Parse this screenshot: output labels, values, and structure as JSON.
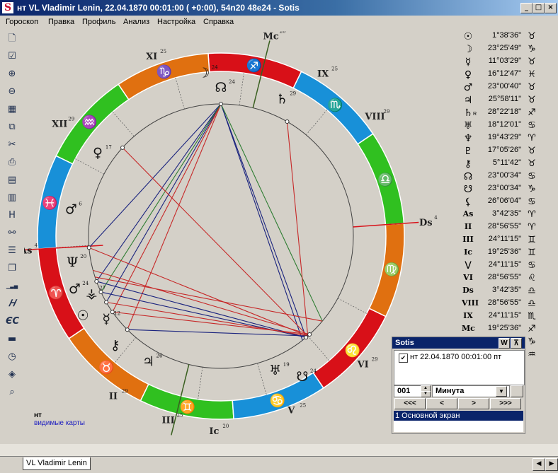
{
  "window": {
    "title": "нт VL Vladimir Lenin, 22.04.1870 00:01:00 ( +0:00), 54n20 48e24 - Sotis",
    "app_icon": "S",
    "controls": {
      "minimize": "_",
      "maximize": "□",
      "close": "×"
    }
  },
  "menu": [
    "Гороскоп",
    "Правка",
    "Профиль",
    "Анализ",
    "Настройка",
    "Справка"
  ],
  "toolbar": [
    {
      "icon": "new-document-icon",
      "glyph": "🗋"
    },
    {
      "icon": "checklist-icon",
      "glyph": "☑"
    },
    {
      "icon": "add-chart-icon",
      "glyph": "⊕"
    },
    {
      "icon": "remove-chart-icon",
      "glyph": "⊖"
    },
    {
      "icon": "texture-icon",
      "glyph": "▦"
    },
    {
      "icon": "copy-icon",
      "glyph": "⧉"
    },
    {
      "icon": "cut-icon",
      "glyph": "✂"
    },
    {
      "icon": "print-icon",
      "glyph": "⎙"
    },
    {
      "icon": "print-preview-icon",
      "glyph": "▤"
    },
    {
      "icon": "report-icon",
      "glyph": "▥"
    },
    {
      "icon": "houses-icon",
      "glyph": "H"
    },
    {
      "icon": "aspects-icon",
      "glyph": "⚯"
    },
    {
      "icon": "list-icon",
      "glyph": "☰"
    },
    {
      "icon": "windows-icon",
      "glyph": "❐"
    },
    {
      "icon": "bar-chart-icon",
      "glyph": "▁▃▅"
    },
    {
      "icon": "italic-h-icon",
      "glyph": "𝐻"
    },
    {
      "icon": "ec-icon",
      "glyph": "ЄС"
    },
    {
      "icon": "folder-icon",
      "glyph": "▬"
    },
    {
      "icon": "clock-icon",
      "glyph": "◷"
    },
    {
      "icon": "map-icon",
      "glyph": "◈"
    },
    {
      "icon": "zoom-icon",
      "glyph": "⌕"
    }
  ],
  "chart": {
    "zodiac_signs": [
      "♈",
      "♉",
      "♊",
      "♋",
      "♌",
      "♍",
      "♎",
      "♏",
      "♐",
      "♑",
      "♒",
      "♓"
    ],
    "house_labels": [
      {
        "name": "As",
        "deg": "4"
      },
      {
        "name": "II",
        "deg": "29"
      },
      {
        "name": "III",
        "deg": "25"
      },
      {
        "name": "Ic",
        "deg": "20"
      },
      {
        "name": "V",
        "deg": "25"
      },
      {
        "name": "VI",
        "deg": "29"
      },
      {
        "name": "Ds",
        "deg": "4"
      },
      {
        "name": "VIII",
        "deg": "29"
      },
      {
        "name": "IX",
        "deg": "25"
      },
      {
        "name": "Mc",
        "deg": "20"
      },
      {
        "name": "XI",
        "deg": "25"
      },
      {
        "name": "XII",
        "deg": "29"
      }
    ],
    "planet_labels": [
      {
        "glyph": "☊",
        "deg": "24"
      },
      {
        "glyph": "☽",
        "deg": "24"
      },
      {
        "glyph": "♄",
        "deg": "29",
        "retro": "R"
      },
      {
        "glyph": "♀",
        "deg": "17"
      },
      {
        "glyph": "♂",
        "deg": "6"
      },
      {
        "glyph": "Ψ",
        "deg": "20"
      },
      {
        "glyph": "♂",
        "deg": "24"
      },
      {
        "glyph": "⚶",
        "deg": "27"
      },
      {
        "glyph": "☉",
        "deg": ""
      },
      {
        "glyph": "☿",
        "deg": "12"
      },
      {
        "glyph": "⚷",
        "deg": ""
      },
      {
        "glyph": "♃",
        "deg": "26"
      },
      {
        "glyph": "♅",
        "deg": "19"
      },
      {
        "glyph": "☋",
        "deg": "24"
      }
    ],
    "colors": {
      "fire": "#d81018",
      "earth": "#e07010",
      "air": "#30c020",
      "water": "#1890d8",
      "axis": "#d81018",
      "mc_axis": "#3a6020"
    }
  },
  "planet_table": [
    {
      "glyph": "☉",
      "degree": "1°38'36\"",
      "sign": "♉"
    },
    {
      "glyph": "☽",
      "degree": "23°25'49\"",
      "sign": "♑"
    },
    {
      "glyph": "☿",
      "degree": "11°03'29\"",
      "sign": "♉"
    },
    {
      "glyph": "♀",
      "degree": "16°12'47\"",
      "sign": "♓"
    },
    {
      "glyph": "♂",
      "degree": "23°00'40\"",
      "sign": "♉"
    },
    {
      "glyph": "♃",
      "degree": "25°58'11\"",
      "sign": "♉"
    },
    {
      "glyph": "♄",
      "degree": "28°22'18\"",
      "sign": "♐",
      "retro": "R"
    },
    {
      "glyph": "♅",
      "degree": "18°12'01\"",
      "sign": "♋"
    },
    {
      "glyph": "♆",
      "degree": "19°43'29\"",
      "sign": "♈"
    },
    {
      "glyph": "♇",
      "degree": "17°05'26\"",
      "sign": "♉"
    },
    {
      "glyph": "⚷",
      "degree": "5°11'42\"",
      "sign": "♉"
    },
    {
      "glyph": "☊",
      "degree": "23°00'34\"",
      "sign": "♋"
    },
    {
      "glyph": "☋",
      "degree": "23°00'34\"",
      "sign": "♑"
    },
    {
      "glyph": "⚸",
      "degree": "26°06'04\"",
      "sign": "♋"
    },
    {
      "glyph": "As",
      "degree": "3°42'35\"",
      "sign": "♈"
    },
    {
      "glyph": "II",
      "degree": "28°56'55\"",
      "sign": "♈"
    },
    {
      "glyph": "III",
      "degree": "24°11'15\"",
      "sign": "♊"
    },
    {
      "glyph": "Ic",
      "degree": "19°25'36\"",
      "sign": "♊"
    },
    {
      "glyph": "V",
      "degree": "24°11'15\"",
      "sign": "♋"
    },
    {
      "glyph": "VI",
      "degree": "28°56'55\"",
      "sign": "♌"
    },
    {
      "glyph": "Ds",
      "degree": "3°42'35\"",
      "sign": "♎"
    },
    {
      "glyph": "VIII",
      "degree": "28°56'55\"",
      "sign": "♎"
    },
    {
      "glyph": "IX",
      "degree": "24°11'15\"",
      "sign": "♏"
    },
    {
      "glyph": "Mc",
      "degree": "19°25'36\"",
      "sign": "♐"
    },
    {
      "glyph": "XI",
      "degree": "24°11'15\"",
      "sign": "♑"
    },
    {
      "glyph": "XII",
      "degree": "28°56'55\"",
      "sign": "♒"
    }
  ],
  "sotis_panel": {
    "title": "Sotis",
    "w_button": "W",
    "pin_button": "⊼",
    "list_item": "нт 22.04.1870 00:01:00 пт",
    "step_value": "001",
    "unit_value": "Минута",
    "nav": [
      "<<<",
      "<",
      ">",
      ">>>"
    ],
    "screen_selected": "1 Основной экран"
  },
  "legend": {
    "label": "нт",
    "link": "видимые карты"
  },
  "tabs": [
    {
      "label": "VL Vladimir Lenin"
    }
  ]
}
